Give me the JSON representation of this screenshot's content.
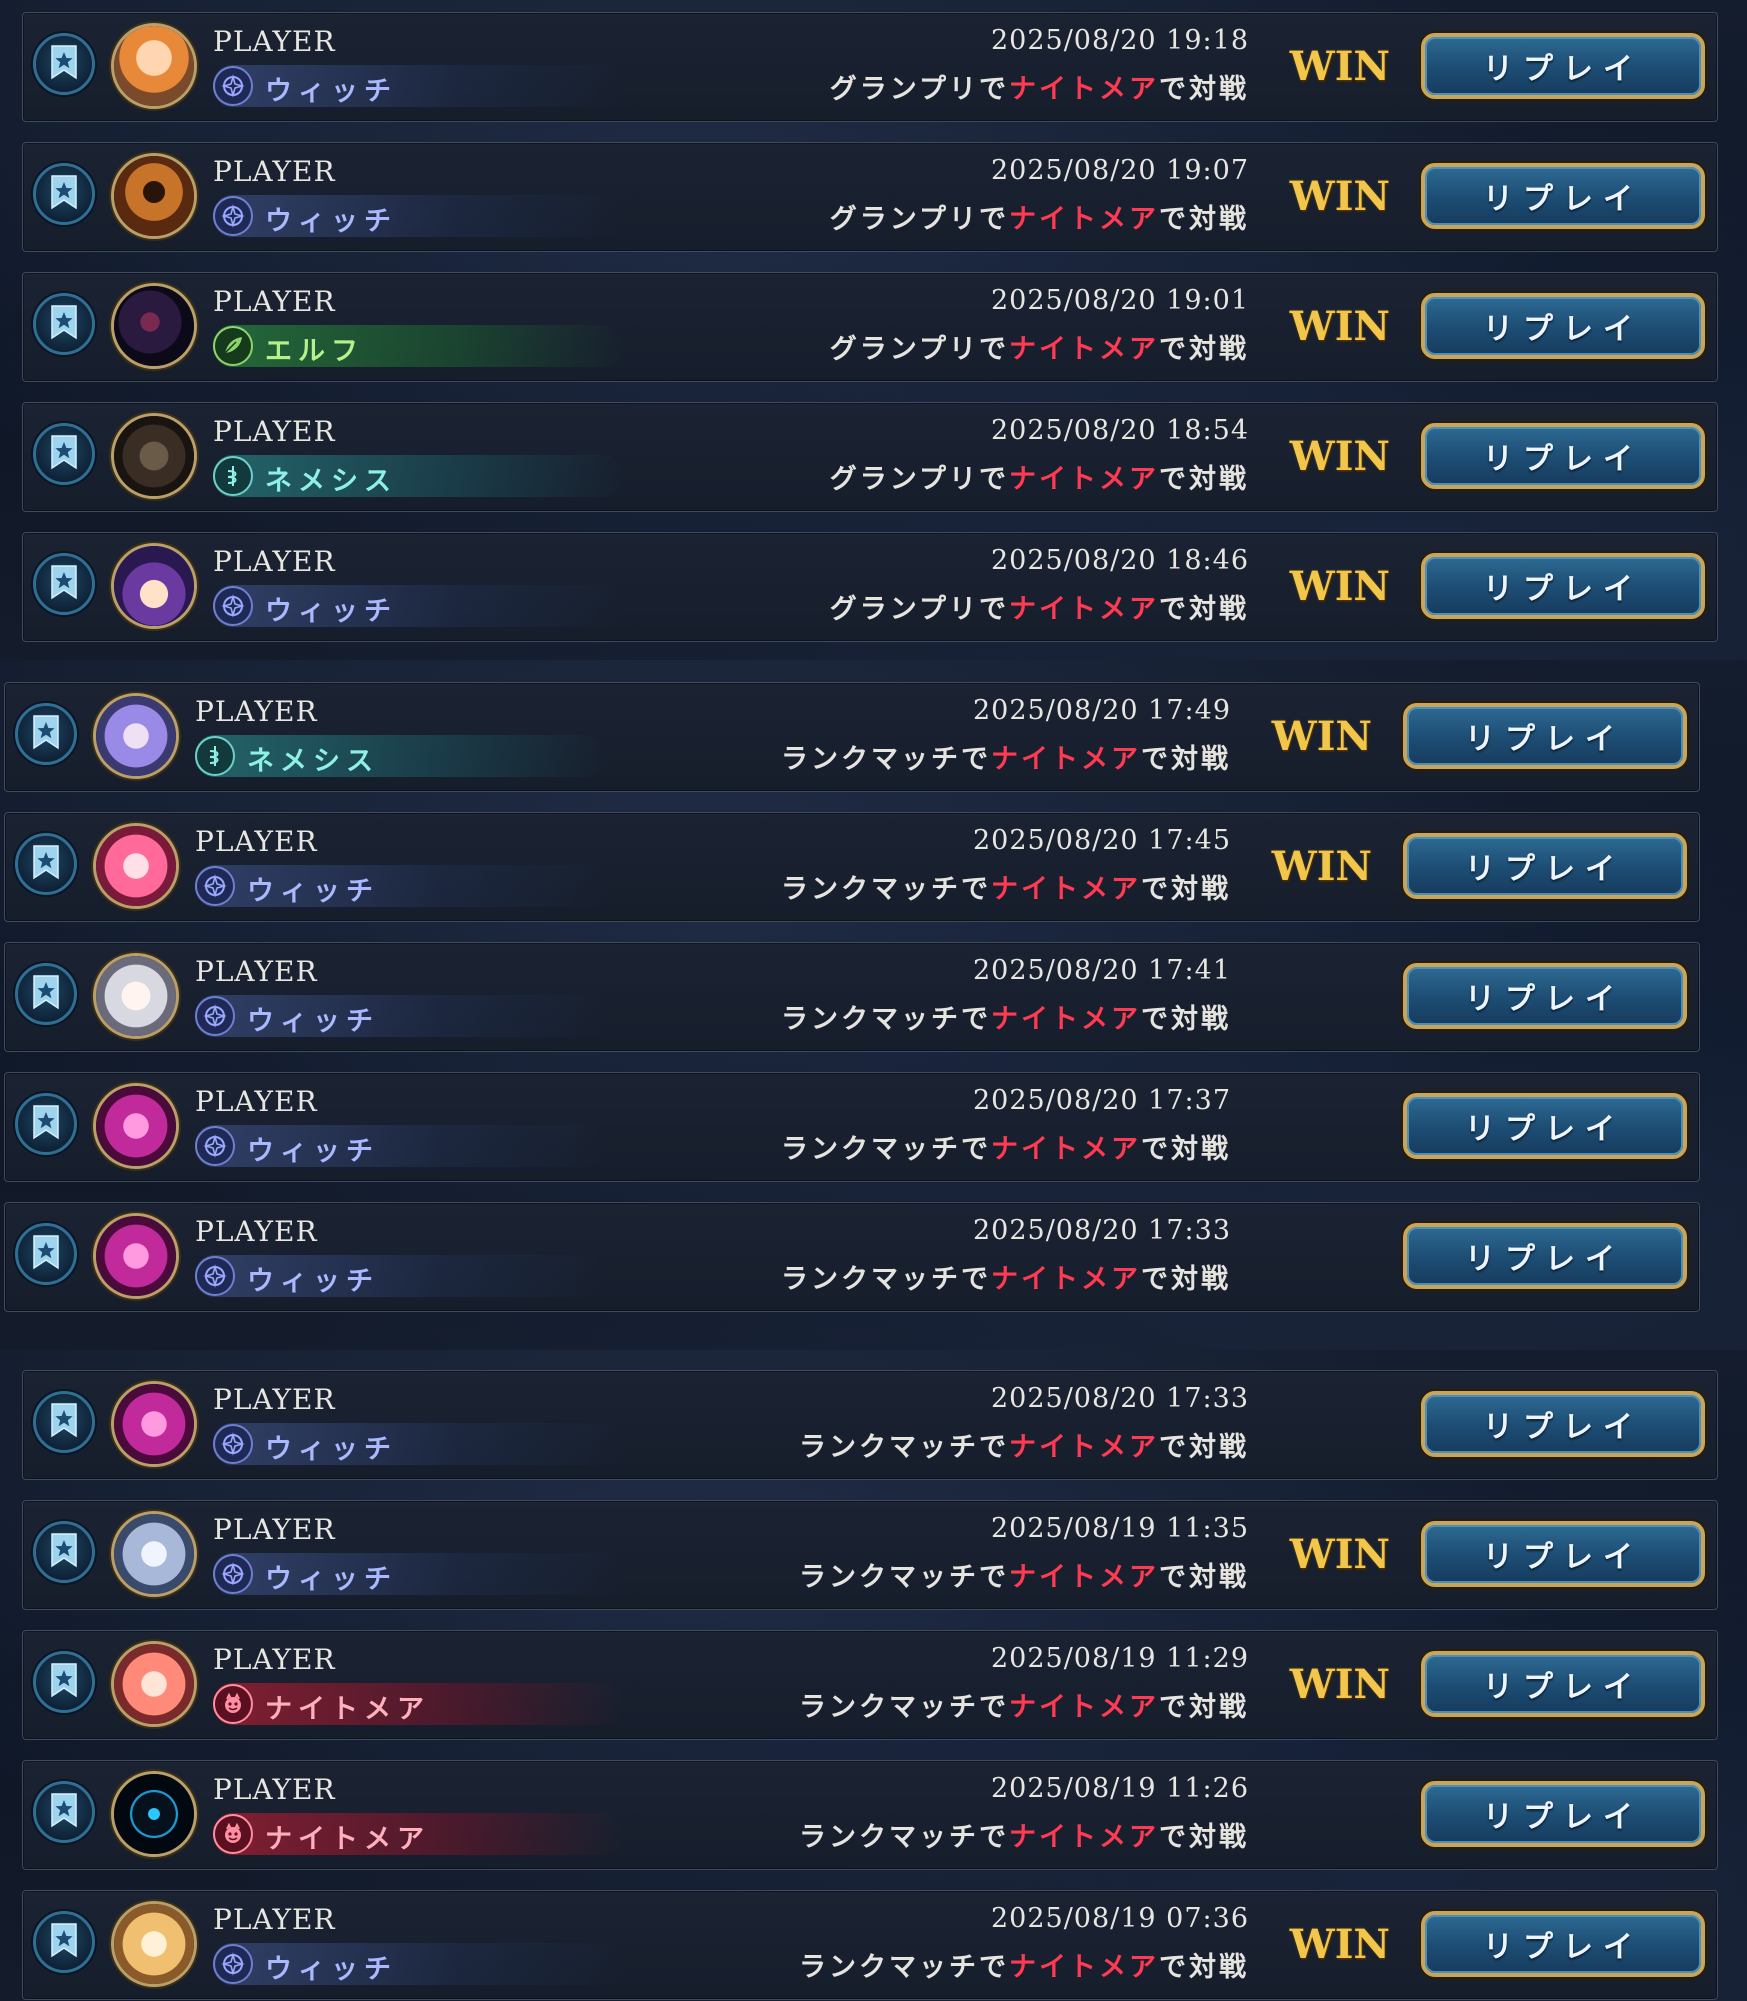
{
  "replay_label": "リプレイ",
  "win_label": "WIN",
  "match_parts": {
    "suffix_mode": "で",
    "opponent": "ナイトメア",
    "end": "で対戦"
  },
  "colors": {
    "win": "#f2c64a",
    "highlight": "#ff3a52",
    "button_border": "#c7a55a"
  },
  "sections": [
    {
      "rows": [
        {
          "player": "PLAYER",
          "class": "ウィッチ",
          "class_key": "witch",
          "datetime": "2025/08/20 19:18",
          "mode": "グランプリ",
          "result": "WIN",
          "avatar": "orange-hair-girl"
        },
        {
          "player": "PLAYER",
          "class": "ウィッチ",
          "class_key": "witch",
          "datetime": "2025/08/20 19:07",
          "mode": "グランプリ",
          "result": "WIN",
          "avatar": "bronze-helmet"
        },
        {
          "player": "PLAYER",
          "class": "エルフ",
          "class_key": "elf",
          "datetime": "2025/08/20 19:01",
          "mode": "グランプリ",
          "result": "WIN",
          "avatar": "dark-dragon"
        },
        {
          "player": "PLAYER",
          "class": "ネメシス",
          "class_key": "nemesis",
          "datetime": "2025/08/20 18:54",
          "mode": "グランプリ",
          "result": "WIN",
          "avatar": "shadow-beast"
        },
        {
          "player": "PLAYER",
          "class": "ウィッチ",
          "class_key": "witch",
          "datetime": "2025/08/20 18:46",
          "mode": "グランプリ",
          "result": "WIN",
          "avatar": "purple-hat-witch"
        }
      ]
    },
    {
      "rows": [
        {
          "player": "PLAYER",
          "class": "ネメシス",
          "class_key": "nemesis",
          "datetime": "2025/08/20 17:49",
          "mode": "ランクマッチ",
          "result": "WIN",
          "avatar": "lavender-hair-girl"
        },
        {
          "player": "PLAYER",
          "class": "ウィッチ",
          "class_key": "witch",
          "datetime": "2025/08/20 17:45",
          "mode": "ランクマッチ",
          "result": "WIN",
          "avatar": "pink-hair-girl"
        },
        {
          "player": "PLAYER",
          "class": "ウィッチ",
          "class_key": "witch",
          "datetime": "2025/08/20 17:41",
          "mode": "ランクマッチ",
          "result": "",
          "avatar": "white-hair-girl"
        },
        {
          "player": "PLAYER",
          "class": "ウィッチ",
          "class_key": "witch",
          "datetime": "2025/08/20 17:37",
          "mode": "ランクマッチ",
          "result": "",
          "avatar": "magenta-girl"
        },
        {
          "player": "PLAYER",
          "class": "ウィッチ",
          "class_key": "witch",
          "datetime": "2025/08/20 17:33",
          "mode": "ランクマッチ",
          "result": "",
          "avatar": "magenta-girl"
        }
      ]
    },
    {
      "rows": [
        {
          "player": "PLAYER",
          "class": "ウィッチ",
          "class_key": "witch",
          "datetime": "2025/08/20 17:33",
          "mode": "ランクマッチ",
          "result": "",
          "avatar": "magenta-girl"
        },
        {
          "player": "PLAYER",
          "class": "ウィッチ",
          "class_key": "witch",
          "datetime": "2025/08/19 11:35",
          "mode": "ランクマッチ",
          "result": "WIN",
          "avatar": "silver-hair-girl"
        },
        {
          "player": "PLAYER",
          "class": "ナイトメア",
          "class_key": "nightmare",
          "datetime": "2025/08/19 11:29",
          "mode": "ランクマッチ",
          "result": "WIN",
          "avatar": "coral-hair-girl"
        },
        {
          "player": "PLAYER",
          "class": "ナイトメア",
          "class_key": "nightmare",
          "datetime": "2025/08/19 11:26",
          "mode": "ランクマッチ",
          "result": "",
          "avatar": "blue-sigil"
        },
        {
          "player": "PLAYER",
          "class": "ウィッチ",
          "class_key": "witch",
          "datetime": "2025/08/19 07:36",
          "mode": "ランクマッチ",
          "result": "WIN",
          "avatar": "blonde-girl"
        }
      ]
    }
  ]
}
